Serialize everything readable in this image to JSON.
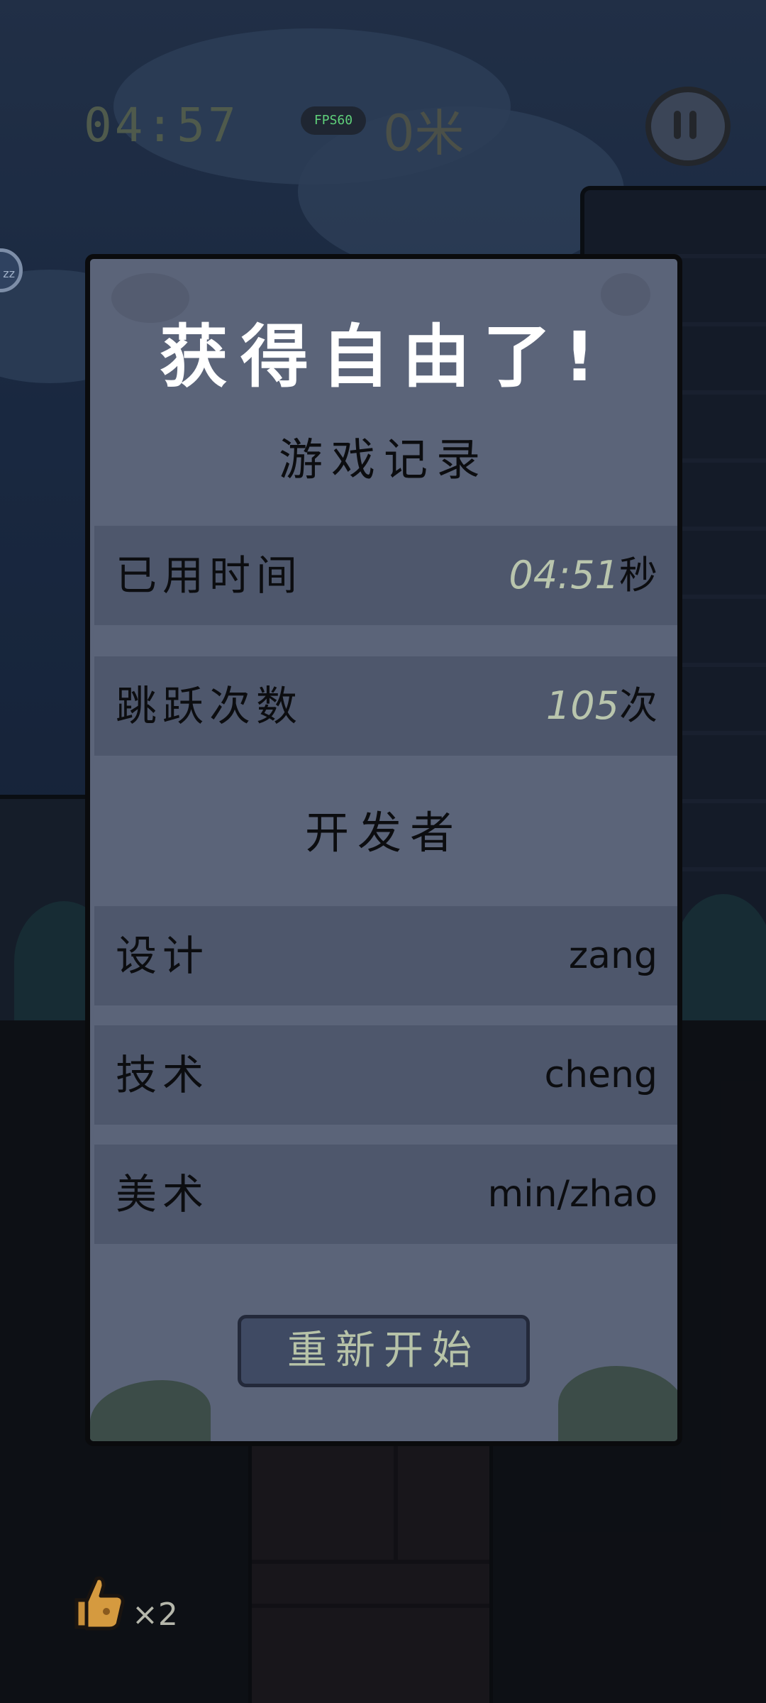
{
  "hud": {
    "timer": "04:57",
    "fps": "FPS60",
    "distance": "0米",
    "side_bubble": "zz"
  },
  "panel": {
    "title": "获得自由了!",
    "record_heading": "游戏记录",
    "records": [
      {
        "label": "已用时间",
        "value": "04:51",
        "unit": "秒"
      },
      {
        "label": "跳跃次数",
        "value": "105",
        "unit": "次"
      }
    ],
    "developers_heading": "开发者",
    "developers": [
      {
        "role": "设计",
        "name": "zang"
      },
      {
        "role": "技术",
        "name": "cheng"
      },
      {
        "role": "美术",
        "name": "min/zhao"
      }
    ],
    "restart_label": "重新开始"
  },
  "lives": {
    "count": "×2",
    "icon": "thumbs-up-icon"
  }
}
